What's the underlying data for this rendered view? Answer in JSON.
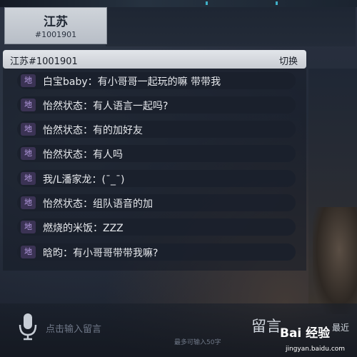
{
  "channel": {
    "name": "江苏",
    "id": "#1001901"
  },
  "chat": {
    "header_title": "江苏#1001901",
    "switch_label": "切换",
    "messages": [
      {
        "badge": "地",
        "text": "白宝baby：有小哥哥一起玩的嘛 带带我"
      },
      {
        "badge": "地",
        "text": "怡然状态：有人语言一起吗?"
      },
      {
        "badge": "地",
        "text": "怡然状态：有的加好友"
      },
      {
        "badge": "地",
        "text": "怡然状态：有人吗"
      },
      {
        "badge": "地",
        "text": "我/L潘家龙：(¯_¯)"
      },
      {
        "badge": "地",
        "text": "怡然状态：组队语音的加"
      },
      {
        "badge": "地",
        "text": "燃烧的米饭：ZZZ"
      },
      {
        "badge": "地",
        "text": "晗昀：有小哥哥带带我嘛?"
      }
    ]
  },
  "input": {
    "placeholder": "点击输入留言",
    "limit_hint": "最多可输入50字"
  },
  "post_button": "留言",
  "recent_label": "最近",
  "watermark": {
    "logo": "Bai 经验",
    "url": "jingyan.baidu.com"
  },
  "colors": {
    "badge_bg": "#3b3354",
    "badge_text": "#b49ae0",
    "header_bg": "#d6d9de"
  }
}
